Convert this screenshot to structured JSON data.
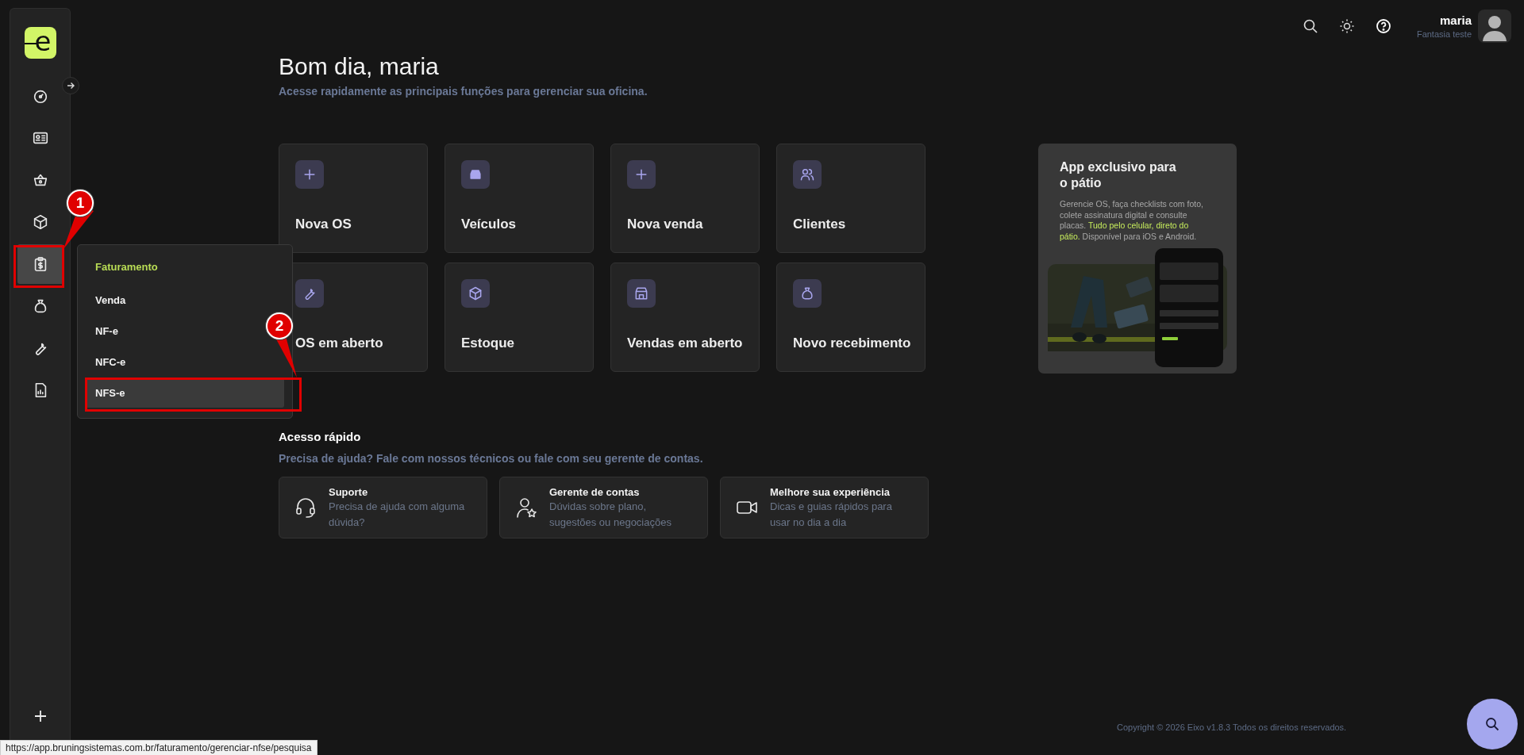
{
  "sidebar": {
    "logo": "e",
    "items": [
      {
        "selected": false
      },
      {
        "selected": false
      },
      {
        "selected": false
      },
      {
        "selected": false
      },
      {
        "selected": true
      },
      {
        "selected": false
      },
      {
        "selected": false
      },
      {
        "selected": false
      }
    ]
  },
  "flyout_menu": {
    "title": "Faturamento",
    "items": [
      {
        "label": "Venda",
        "selected": false
      },
      {
        "label": "NF-e",
        "selected": false
      },
      {
        "label": "NFC-e",
        "selected": false
      },
      {
        "label": "NFS-e",
        "selected": true
      }
    ]
  },
  "header": {
    "user_name": "maria",
    "company": "Fantasia teste"
  },
  "greeting": "Bom dia, maria",
  "subtitle": "Acesse rapidamente as principais funções para gerenciar sua oficina.",
  "shortcuts": [
    {
      "label": "Nova OS"
    },
    {
      "label": "Veículos"
    },
    {
      "label": "Nova venda"
    },
    {
      "label": "Clientes"
    },
    {
      "label": "OS em aberto"
    },
    {
      "label": "Estoque"
    },
    {
      "label": "Vendas em aberto"
    },
    {
      "label": "Novo recebimento"
    }
  ],
  "promo": {
    "title": "App exclusivo para o pátio",
    "body": [
      {
        "text": "Gerencie OS, faça checklists com foto, colete assinatura digital e consulte placas. ",
        "highlight": false
      },
      {
        "text": "Tudo pelo celular, direto do pátio.",
        "highlight": true
      },
      {
        "text": " Disponível para iOS e Android.",
        "highlight": false
      }
    ]
  },
  "quick_access": {
    "title": "Acesso rápido",
    "subtitle": "Precisa de ajuda? Fale com nossos técnicos ou fale com seu gerente de contas.",
    "cards": [
      {
        "title": "Suporte",
        "description": "Precisa de ajuda com alguma dúvida?"
      },
      {
        "title": "Gerente de contas",
        "description": "Dúvidas sobre plano, sugestões ou negociações"
      },
      {
        "title": "Melhore sua experiência",
        "description": "Dicas e guias rápidos para usar no dia a dia"
      }
    ]
  },
  "footer": "Copyright © 2026 Eixo v1.8.3 Todos os direitos reservados.",
  "status_url": "https://app.bruningsistemas.com.br/faturamento/gerenciar-nfse/pesquisa",
  "callouts": [
    {
      "number": "1"
    },
    {
      "number": "2"
    }
  ]
}
